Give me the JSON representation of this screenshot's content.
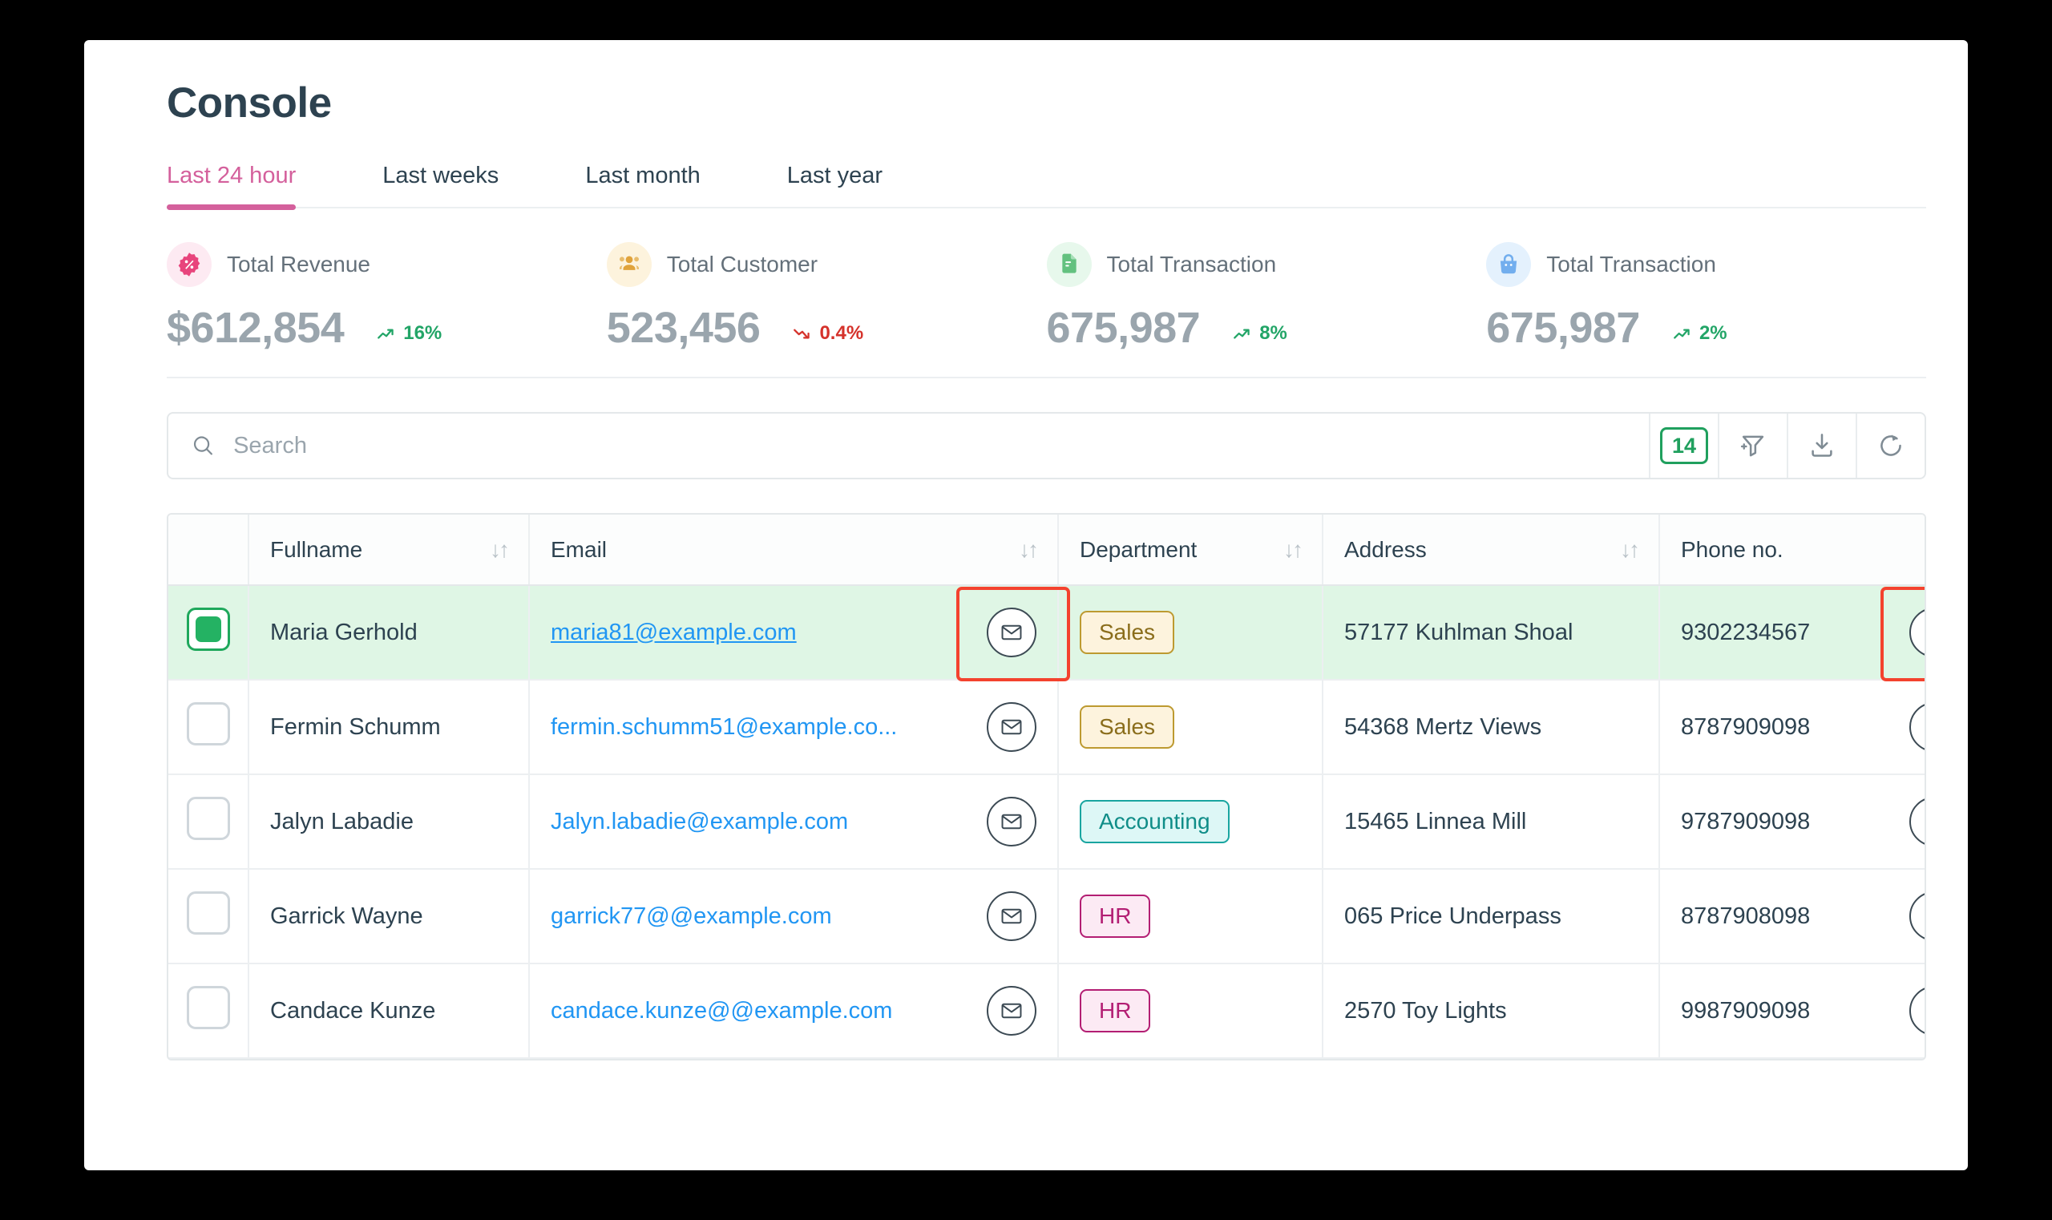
{
  "header": {
    "title": "Console"
  },
  "tabs": [
    {
      "label": "Last 24 hour",
      "active": true
    },
    {
      "label": "Last weeks",
      "active": false
    },
    {
      "label": "Last month",
      "active": false
    },
    {
      "label": "Last year",
      "active": false
    }
  ],
  "stats": [
    {
      "icon": "discount-percent-icon",
      "label": "Total Revenue",
      "value": "$612,854",
      "delta": "16%",
      "direction": "up",
      "icon_color": "#e8447c",
      "icon_bg": "#fdeaf2"
    },
    {
      "icon": "users-icon",
      "label": "Total Customer",
      "value": "523,456",
      "delta": "0.4%",
      "direction": "down",
      "icon_color": "#e0a33c",
      "icon_bg": "#fdf3dd"
    },
    {
      "icon": "document-icon",
      "label": "Total Transaction",
      "value": "675,987",
      "delta": "8%",
      "direction": "up",
      "icon_color": "#63c17f",
      "icon_bg": "#e7f8ec"
    },
    {
      "icon": "shopping-bag-icon",
      "label": "Total Transaction",
      "value": "675,987",
      "delta": "2%",
      "direction": "up",
      "icon_color": "#72aeee",
      "icon_bg": "#e4f1fd"
    }
  ],
  "toolbar": {
    "search_placeholder": "Search",
    "search_value": "",
    "count_badge": "14",
    "filter_icon": "filter-add-icon",
    "download_icon": "download-icon",
    "refresh_icon": "refresh-icon",
    "badge_color": "#20a05e"
  },
  "table": {
    "columns": [
      {
        "label": "",
        "sortable": false
      },
      {
        "label": "Fullname",
        "sortable": true
      },
      {
        "label": "Email",
        "sortable": true
      },
      {
        "label": "Department",
        "sortable": true
      },
      {
        "label": "Address",
        "sortable": true
      },
      {
        "label": "Phone no.",
        "sortable": true
      }
    ],
    "sort_icon": "sort-updown-icon",
    "rows": [
      {
        "selected": true,
        "fullname": "Maria Gerhold",
        "email": "maria81@example.com",
        "email_underlined": true,
        "department": "Sales",
        "department_style": "sales",
        "address": "57177 Kuhlman Shoal",
        "phone": "9302234567"
      },
      {
        "selected": false,
        "fullname": "Fermin Schumm",
        "email": "fermin.schumm51@example.co...",
        "email_underlined": false,
        "department": "Sales",
        "department_style": "sales",
        "address": "54368 Mertz Views",
        "phone": "8787909098"
      },
      {
        "selected": false,
        "fullname": "Jalyn Labadie",
        "email": "Jalyn.labadie@example.com",
        "email_underlined": false,
        "department": "Accounting",
        "department_style": "accounting",
        "address": "15465 Linnea Mill",
        "phone": "9787909098"
      },
      {
        "selected": false,
        "fullname": "Garrick Wayne",
        "email": "garrick77@@example.com",
        "email_underlined": false,
        "department": "HR",
        "department_style": "hr",
        "address": "065 Price Underpass",
        "phone": "8787908098"
      },
      {
        "selected": false,
        "fullname": "Candace Kunze",
        "email": "candace.kunze@@example.com",
        "email_underlined": false,
        "department": "HR",
        "department_style": "hr",
        "address": "2570 Toy Lights",
        "phone": "9987909098"
      }
    ],
    "row_action_email_icon": "envelope-icon",
    "row_action_phone_icon": "phone-icon"
  },
  "highlights": {
    "email_action_color": "#f4422e",
    "phone_action_color": "#f4422e"
  }
}
